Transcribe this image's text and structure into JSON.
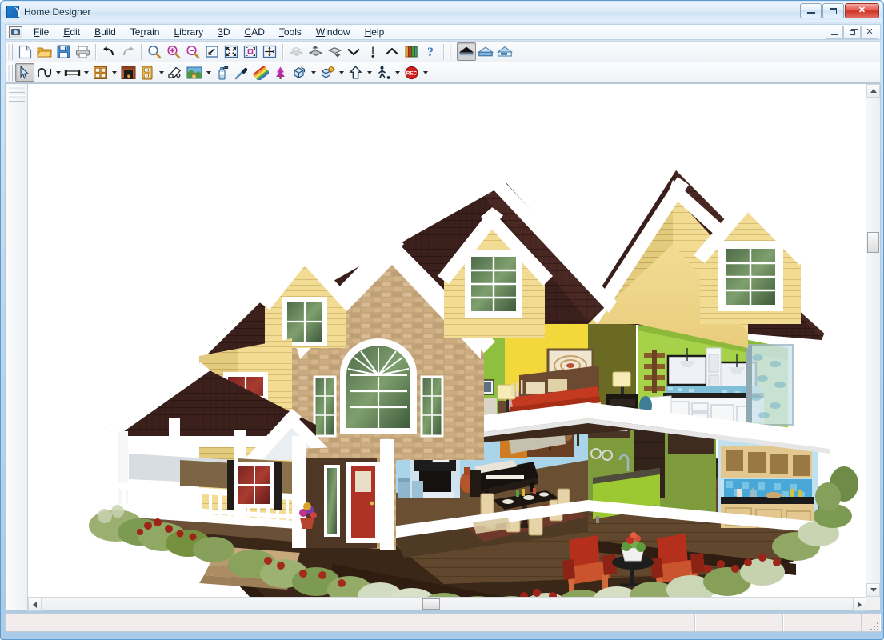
{
  "window": {
    "title": "Home Designer",
    "app_icon": "home-designer-logo-icon",
    "controls": {
      "minimize": "minimize-icon",
      "maximize": "maximize-icon",
      "close": "✕"
    }
  },
  "mdi_controls": {
    "minimize": "mdi-minimize-icon",
    "restore": "mdi-restore-icon",
    "close": "✕"
  },
  "menubar": {
    "system_button": "document-control-icon",
    "items": [
      {
        "label": "File",
        "accel": "F"
      },
      {
        "label": "Edit",
        "accel": "E"
      },
      {
        "label": "Build",
        "accel": "B"
      },
      {
        "label": "Terrain",
        "accel": "r"
      },
      {
        "label": "Library",
        "accel": "L"
      },
      {
        "label": "3D",
        "accel": "3"
      },
      {
        "label": "CAD",
        "accel": "C"
      },
      {
        "label": "Tools",
        "accel": "T"
      },
      {
        "label": "Window",
        "accel": "W"
      },
      {
        "label": "Help",
        "accel": "H"
      }
    ]
  },
  "toolbar_top": {
    "buttons": [
      {
        "name": "new-plan-icon",
        "tooltip": "New Plan"
      },
      {
        "name": "open-plan-icon",
        "tooltip": "Open Plan"
      },
      {
        "name": "save-icon",
        "tooltip": "Save Plan"
      },
      {
        "name": "print-icon",
        "tooltip": "Print"
      },
      {
        "name": "undo-icon",
        "tooltip": "Undo"
      },
      {
        "name": "redo-icon",
        "tooltip": "Redo",
        "disabled": true
      },
      {
        "name": "zoom-icon",
        "tooltip": "Zoom"
      },
      {
        "name": "zoom-in-icon",
        "tooltip": "Zoom In"
      },
      {
        "name": "zoom-out-icon",
        "tooltip": "Zoom Out"
      },
      {
        "name": "undo-zoom-icon",
        "tooltip": "Undo Zoom"
      },
      {
        "name": "fill-window-icon",
        "tooltip": "Fill Window"
      },
      {
        "name": "fill-window-building-icon",
        "tooltip": "Fill Window Building Only"
      },
      {
        "name": "pan-view-icon",
        "tooltip": "Pan Window"
      },
      {
        "name": "previous-floor-icon",
        "tooltip": "Previous Floor",
        "disabled": true
      },
      {
        "name": "floor-up-icon",
        "tooltip": "Floor Up"
      },
      {
        "name": "floor-down-icon",
        "tooltip": "Floor Down"
      },
      {
        "name": "chevron-down-icon",
        "tooltip": "Down One Floor"
      },
      {
        "name": "reference-display-icon",
        "tooltip": "Reference Display"
      },
      {
        "name": "chevron-up-icon",
        "tooltip": "Up One Floor"
      },
      {
        "name": "library-browser-icon",
        "tooltip": "Library Browser"
      },
      {
        "name": "help-icon",
        "tooltip": "Help"
      }
    ],
    "view_modes": [
      {
        "name": "full-camera-view-icon",
        "tooltip": "Full Camera View",
        "active": true
      },
      {
        "name": "glass-house-view-icon",
        "tooltip": "Glass House View",
        "active": false
      },
      {
        "name": "framing-overview-icon",
        "tooltip": "Framing Overview",
        "active": false
      }
    ]
  },
  "toolbar_bottom": {
    "buttons": [
      {
        "name": "select-objects-icon",
        "tooltip": "Select Objects",
        "active": true,
        "caret": false
      },
      {
        "name": "draw-curve-icon",
        "tooltip": "Draw Spline",
        "active": false,
        "caret": true
      },
      {
        "name": "draw-wall-icon",
        "tooltip": "Straight Exterior Wall",
        "active": false,
        "caret": true
      },
      {
        "name": "cabinet-icon",
        "tooltip": "Base Cabinet",
        "active": false,
        "caret": true
      },
      {
        "name": "fireplace-icon",
        "tooltip": "Fireplace",
        "active": false,
        "caret": false
      },
      {
        "name": "electrical-outlet-icon",
        "tooltip": "Electrical",
        "active": false,
        "caret": true
      },
      {
        "name": "camera-icon",
        "tooltip": "Full Camera",
        "active": false,
        "caret": false
      },
      {
        "name": "terrain-perimeter-icon",
        "tooltip": "Terrain Perimeter",
        "active": false,
        "caret": true
      },
      {
        "name": "spray-paint-icon",
        "tooltip": "Material Painter",
        "active": false,
        "caret": false
      },
      {
        "name": "eyedropper-icon",
        "tooltip": "Material Eyedropper",
        "active": false,
        "caret": false
      },
      {
        "name": "color-gradient-icon",
        "tooltip": "Adjust Material Definition",
        "active": false,
        "caret": false
      },
      {
        "name": "plant-icon",
        "tooltip": "Plant Chooser",
        "active": false,
        "caret": false
      },
      {
        "name": "3d-box-icon",
        "tooltip": "Primitive Box",
        "active": false,
        "caret": true
      },
      {
        "name": "3d-lighting-icon",
        "tooltip": "Adjust Lighting",
        "active": false,
        "caret": true
      },
      {
        "name": "move-up-icon",
        "tooltip": "Move Up One Level",
        "active": false,
        "caret": true
      },
      {
        "name": "walkthrough-icon",
        "tooltip": "Walkthrough",
        "active": false,
        "caret": true
      },
      {
        "name": "record-walkthrough-icon",
        "tooltip": "Record Walkthrough",
        "active": false,
        "caret": true
      }
    ]
  },
  "canvas": {
    "view_name": "3d-house-rendering",
    "scene": {
      "description": "3D cutaway rendering of a two-story suburban home with dollhouse view",
      "exterior": {
        "roof_color": "#3a1f1b",
        "siding_color": "#f2d88a",
        "stone_color": "#c6a579",
        "trim_color": "#ffffff",
        "shutter_color": "#2a2320",
        "door_color": "#8e2018",
        "deck_color": "#5c4430"
      },
      "rooms": [
        {
          "name": "master-bedroom",
          "floor": "upper",
          "wall_color": "#f2d83a",
          "accent": "#6b6a24",
          "items": [
            "bed",
            "nightstands",
            "lamps",
            "framed-art",
            "dresser"
          ]
        },
        {
          "name": "sitting-room",
          "floor": "upper",
          "wall_color": "#8fbf3f",
          "accent": "#4c5a33",
          "items": [
            "armchair",
            "ottoman",
            "bookcase",
            "side-table"
          ]
        },
        {
          "name": "master-bathroom",
          "floor": "upper",
          "wall_color": "#a6d24a",
          "accent": "#ffffff",
          "items": [
            "double-vanity",
            "mirrors",
            "soaking-tub",
            "glass-shower",
            "pendant-lights"
          ]
        },
        {
          "name": "living-room",
          "floor": "main",
          "wall_color": "#a9d4ea",
          "accent": "#f0a63c",
          "items": [
            "fireplace",
            "grand-piano",
            "armchairs",
            "floor-lamps",
            "area-rug"
          ]
        },
        {
          "name": "dining-area",
          "floor": "main",
          "wall_color": "#a9d4ea",
          "accent": "#6b3f22",
          "items": [
            "dining-table",
            "six-chairs",
            "pendant-light",
            "table-settings"
          ]
        },
        {
          "name": "kitchen",
          "floor": "main",
          "wall_color": "#7f9c3c",
          "accent": "#9cc832",
          "items": [
            "green-island",
            "sink",
            "refrigerator",
            "wood-cabinets",
            "blue-tile-backsplash",
            "pendant-lights"
          ]
        }
      ],
      "exterior_features": [
        "covered-front-porch",
        "white-porch-railing",
        "gable-dormers",
        "arched-palladian-window",
        "stone-veneer-facade",
        "rear-deck",
        "adirondack-chairs",
        "patio-table-planter",
        "landscaped-flower-beds",
        "stone-retaining-wall",
        "front-steps"
      ]
    }
  },
  "scrollbars": {
    "vertical": {
      "name": "vertical-scrollbar",
      "thumb_position_pct": 29
    },
    "horizontal": {
      "name": "horizontal-scrollbar",
      "thumb_position_pct": 48
    }
  },
  "status_bar": {
    "cells": [
      "",
      "",
      "",
      ""
    ]
  }
}
